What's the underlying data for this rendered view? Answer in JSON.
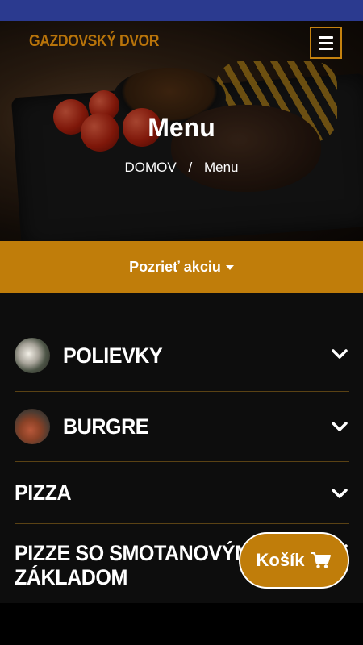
{
  "brand": {
    "name": "GAZDOVSKÝ DVOR",
    "color": "#b9740a"
  },
  "header": {
    "menu_icon": "hamburger-menu-icon"
  },
  "hero": {
    "title": "Menu",
    "breadcrumb": [
      "DOMOV",
      "/",
      "Menu"
    ]
  },
  "promo": {
    "label": "Pozrieť akciu",
    "icon": "caret-down-icon",
    "color": "#c07d0a"
  },
  "categories": [
    {
      "name": "POLIEVKY",
      "icon": "chevron-down-icon"
    },
    {
      "name": "BURGRE",
      "icon": "chevron-down-icon"
    },
    {
      "name": "PIZZA",
      "icon": "chevron-down-icon"
    },
    {
      "name": "PIZZE SO SMOTANOVÝM ZÁKLADOM",
      "line1": "PIZZE SO SMOTANOVÝM",
      "line2": "ZÁKLADOM",
      "icon": "chevron-down-icon"
    }
  ],
  "cart": {
    "label": "Košík",
    "icon": "cart-icon"
  },
  "colors": {
    "topbar": "#2b3a8f",
    "accent": "#c07d0a",
    "background": "#0d0d0d"
  }
}
